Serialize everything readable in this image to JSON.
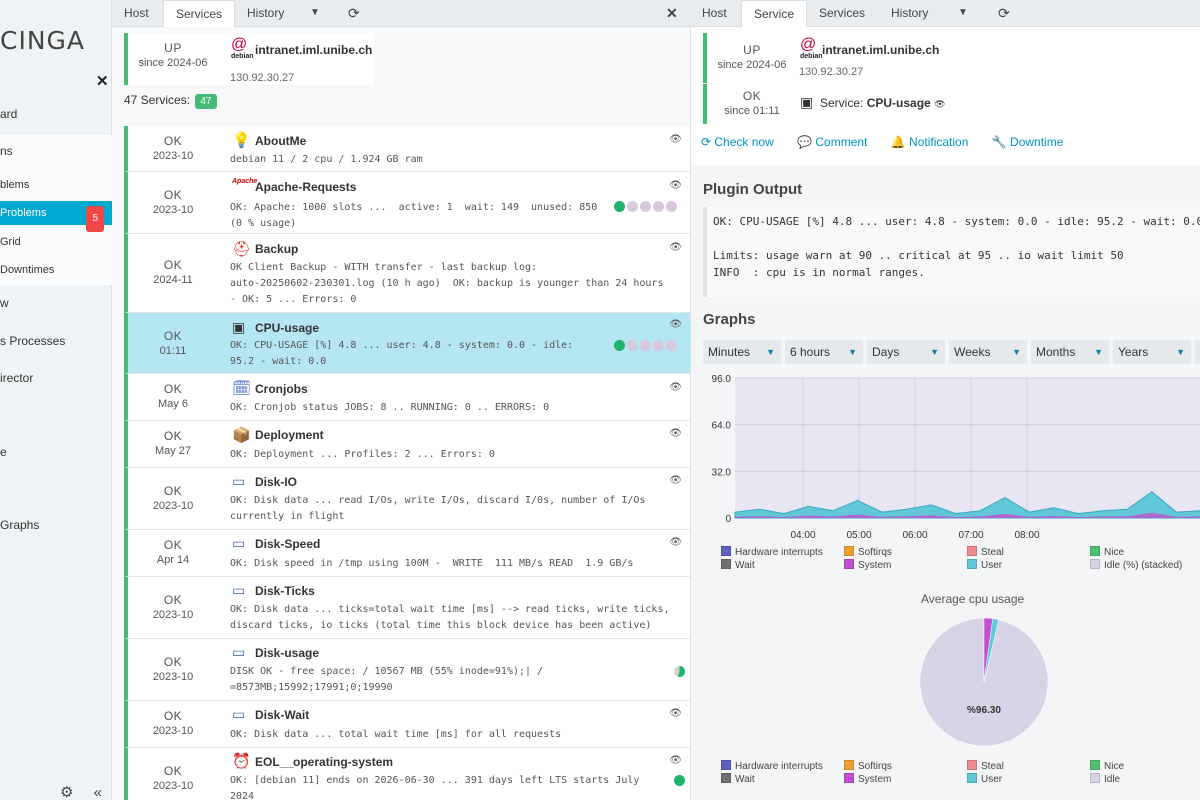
{
  "sidebar": {
    "logo": "CINGA",
    "items": [
      {
        "label": "ard"
      },
      {
        "label": "ns"
      },
      {
        "label": "blems"
      },
      {
        "label": "Problems",
        "badge": "5"
      },
      {
        "label": "Grid"
      },
      {
        "label": "Downtimes"
      },
      {
        "label": "w"
      },
      {
        "label": "s Processes"
      },
      {
        "label": "irector"
      },
      {
        "label": "e"
      },
      {
        "label": "Graphs"
      }
    ]
  },
  "left_tabs": [
    "Host",
    "Services",
    "History"
  ],
  "right_tabs": [
    "Host",
    "Service",
    "Services",
    "History"
  ],
  "host": {
    "state": "UP",
    "since": "since 2024-06",
    "os_label": "debian",
    "name": "intranet.iml.unibe.ch",
    "address": "130.92.30.27"
  },
  "services_count_label": "47 Services:",
  "services_count_badge": "47",
  "services": [
    {
      "state": "OK",
      "since": "2023-10",
      "name": "AboutMe",
      "output": "debian 11 / 2 cpu / 1.924 GB ram"
    },
    {
      "state": "OK",
      "since": "2023-10",
      "name": "Apache-Requests",
      "output": "OK: Apache: 1000 slots ...  active: 1  wait: 149  unused: 850\n(0 % usage)"
    },
    {
      "state": "OK",
      "since": "2024-11",
      "name": "Backup",
      "output": "OK Client Backup - WITH transfer - last backup log:\nauto-20250602-230301.log (10 h ago)  OK: backup is younger than 24 hours\n- OK: 5 ... Errors: 0"
    },
    {
      "state": "OK",
      "since": "01:11",
      "name": "CPU-usage",
      "output": "OK: CPU-USAGE [%] 4.8 ... user: 4.8 - system: 0.0 - idle:\n95.2 - wait: 0.0"
    },
    {
      "state": "OK",
      "since": "May 6",
      "name": "Cronjobs",
      "output": "OK: Cronjob status JOBS: 8 .. RUNNING: 0 .. ERRORS: 0"
    },
    {
      "state": "OK",
      "since": "May 27",
      "name": "Deployment",
      "output": "OK: Deployment ... Profiles: 2 ... Errors: 0"
    },
    {
      "state": "OK",
      "since": "2023-10",
      "name": "Disk-IO",
      "output": "OK: Disk data ... read I/Os, write I/Os, discard I/0s, number of I/Os\ncurrently in flight"
    },
    {
      "state": "OK",
      "since": "Apr 14",
      "name": "Disk-Speed",
      "output": "OK: Disk speed in /tmp using 100M -  WRITE  111 MB/s READ  1.9 GB/s"
    },
    {
      "state": "OK",
      "since": "2023-10",
      "name": "Disk-Ticks",
      "output": "OK: Disk data ... ticks=total wait time [ms] --> read ticks, write ticks,\ndiscard ticks, io ticks (total time this block device has been active)"
    },
    {
      "state": "OK",
      "since": "2023-10",
      "name": "Disk-usage",
      "output": "DISK OK - free space: / 10567 MB (55% inode=91%);| /\n=8573MB;15992;17991;0;19990"
    },
    {
      "state": "OK",
      "since": "2023-10",
      "name": "Disk-Wait",
      "output": "OK: Disk data ... total wait time [ms] for all requests"
    },
    {
      "state": "OK",
      "since": "2023-10",
      "name": "EOL__operating-system",
      "output": "OK: [debian 11] ends on 2026-06-30 ... 391 days left LTS starts July\n2024"
    }
  ],
  "detail": {
    "service_state": "OK",
    "service_since": "since 01:11",
    "service_prefix": "Service:",
    "service_name": "CPU-usage",
    "actions": [
      "Check now",
      "Comment",
      "Notification",
      "Downtime"
    ],
    "plugin_output_title": "Plugin Output",
    "plugin_output": "OK: CPU-USAGE [%] 4.8 ... user: 4.8 - system: 0.0 - idle: 95.2 - wait: 0.0\n\nLimits: usage warn at 90 .. critical at 95 .. io wait limit 50\nINFO  : cpu is in normal ranges.",
    "graphs_title": "Graphs",
    "time_selects": [
      "Minutes",
      "6 hours",
      "Days",
      "Weeks",
      "Months",
      "Years"
    ],
    "pie_title": "Average cpu usage",
    "pie_label": "%96.30"
  },
  "colors": {
    "ok_green": "#44bb77",
    "accent": "#00a8d2",
    "selected_row": "#b5e7f2",
    "badge_red": "#f04646",
    "badge_green": "#44bb77"
  },
  "chart_data": [
    {
      "type": "area",
      "title": "",
      "y_ticks": [
        "96.0",
        "64.0",
        "32.0",
        "0"
      ],
      "x_ticks": [
        "04:00",
        "05:00",
        "06:00",
        "07:00",
        "08:00"
      ],
      "ylim": [
        0,
        96
      ],
      "legend_placement": "bottom",
      "series": [
        {
          "name": "Hardware interrupts",
          "color": "#6060c0"
        },
        {
          "name": "Softirqs",
          "color": "#f0a030"
        },
        {
          "name": "Steal",
          "color": "#f08a8a"
        },
        {
          "name": "Nice",
          "color": "#50c070"
        },
        {
          "name": "Wait",
          "color": "#707070"
        },
        {
          "name": "System",
          "color": "#c050d0"
        },
        {
          "name": "User",
          "color": "#60c8d8"
        },
        {
          "name": "Idle (%) (stacked)",
          "color": "#d8d4e8"
        }
      ],
      "approx_user_values": [
        4,
        6,
        3,
        8,
        5,
        12,
        4,
        6,
        9,
        3,
        5,
        14,
        4,
        7,
        3,
        5,
        6,
        18,
        4,
        5
      ]
    },
    {
      "type": "pie",
      "title": "Average cpu usage",
      "slices": [
        {
          "name": "Idle",
          "value": 96.3
        },
        {
          "name": "System",
          "value": 2.2
        },
        {
          "name": "User",
          "value": 1.5
        }
      ],
      "series": [
        {
          "name": "Hardware interrupts",
          "color": "#6060c0"
        },
        {
          "name": "Softirqs",
          "color": "#f0a030"
        },
        {
          "name": "Steal",
          "color": "#f08a8a"
        },
        {
          "name": "Nice",
          "color": "#50c070"
        },
        {
          "name": "Wait",
          "color": "#707070"
        },
        {
          "name": "System",
          "color": "#c050d0"
        },
        {
          "name": "User",
          "color": "#60c8d8"
        },
        {
          "name": "Idle",
          "color": "#d8d4e8"
        }
      ]
    }
  ]
}
